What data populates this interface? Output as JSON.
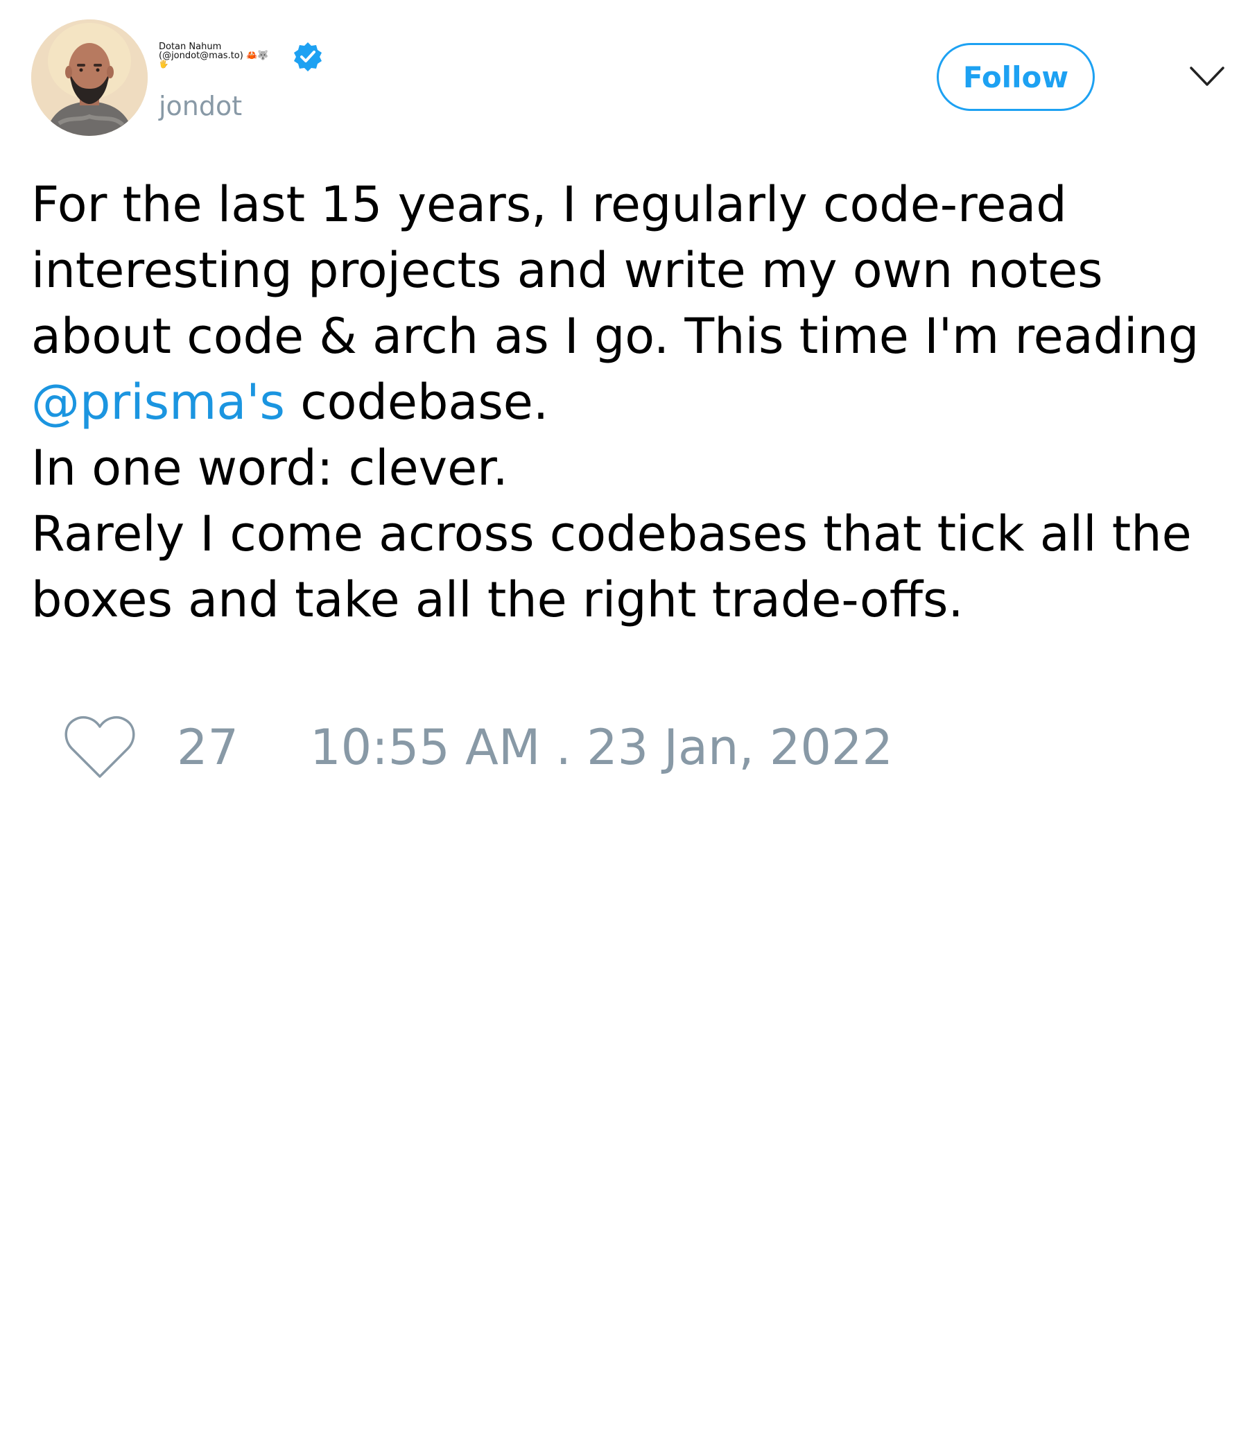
{
  "author": {
    "display_name": "Dotan Nahum",
    "display_name_line2": "(@jondot@mas.to) 🦀🐺",
    "display_name_line3": "🖐",
    "handle": "jondot",
    "verified": true
  },
  "header": {
    "follow_label": "Follow"
  },
  "tweet": {
    "line1": "For the last 15 years, I regularly code-read",
    "line2": "interesting projects and write my own notes",
    "line3": "about code & arch as I go. This time I'm reading",
    "mention": "@prisma's",
    "line4_rest": " codebase.",
    "line5": "In one word: clever.",
    "line6": "Rarely I come across codebases that tick all the",
    "line7": "boxes and take all the right trade-offs."
  },
  "footer": {
    "like_count": "27",
    "timestamp": "10:55 AM . 23 Jan, 2022"
  },
  "colors": {
    "accent": "#1da1f2",
    "mention": "#1b95e0",
    "muted": "#8899a6",
    "text": "#000000"
  },
  "icons": {
    "verified": "verified-badge-icon",
    "menu": "chevron-down-icon",
    "like": "heart-icon"
  }
}
